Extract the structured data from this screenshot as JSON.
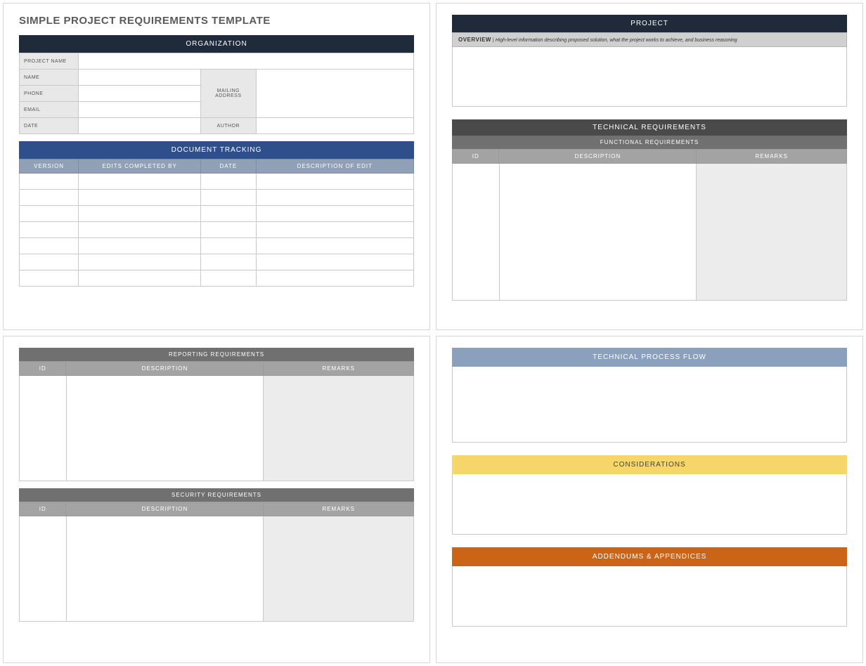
{
  "title": "SIMPLE PROJECT REQUIREMENTS TEMPLATE",
  "panel1": {
    "org_header": "ORGANIZATION",
    "fields": {
      "project_name": "PROJECT NAME",
      "name": "NAME",
      "phone": "PHONE",
      "email": "EMAIL",
      "date": "DATE",
      "mailing_address": "MAILING ADDRESS",
      "author": "AUTHOR"
    },
    "tracking_header": "DOCUMENT TRACKING",
    "tracking_cols": {
      "version": "VERSION",
      "edits_by": "EDITS COMPLETED BY",
      "date": "DATE",
      "desc": "DESCRIPTION OF EDIT"
    }
  },
  "panel2": {
    "project_header": "PROJECT",
    "overview_label": "OVERVIEW",
    "overview_separator": "  |  ",
    "overview_hint": "High-level information describing proposed solution, what the project works to achieve, and business reasoning",
    "tech_req_header": "TECHNICAL REQUIREMENTS",
    "func_req_header": "FUNCTIONAL REQUIREMENTS",
    "cols": {
      "id": "ID",
      "desc": "DESCRIPTION",
      "remarks": "REMARKS"
    }
  },
  "panel3": {
    "reporting_header": "REPORTING REQUIREMENTS",
    "security_header": "SECURITY REQUIREMENTS",
    "cols": {
      "id": "ID",
      "desc": "DESCRIPTION",
      "remarks": "REMARKS"
    }
  },
  "panel4": {
    "flow_header": "TECHNICAL PROCESS FLOW",
    "considerations_header": "CONSIDERATIONS",
    "addendums_header": "ADDENDUMS & APPENDICES"
  }
}
